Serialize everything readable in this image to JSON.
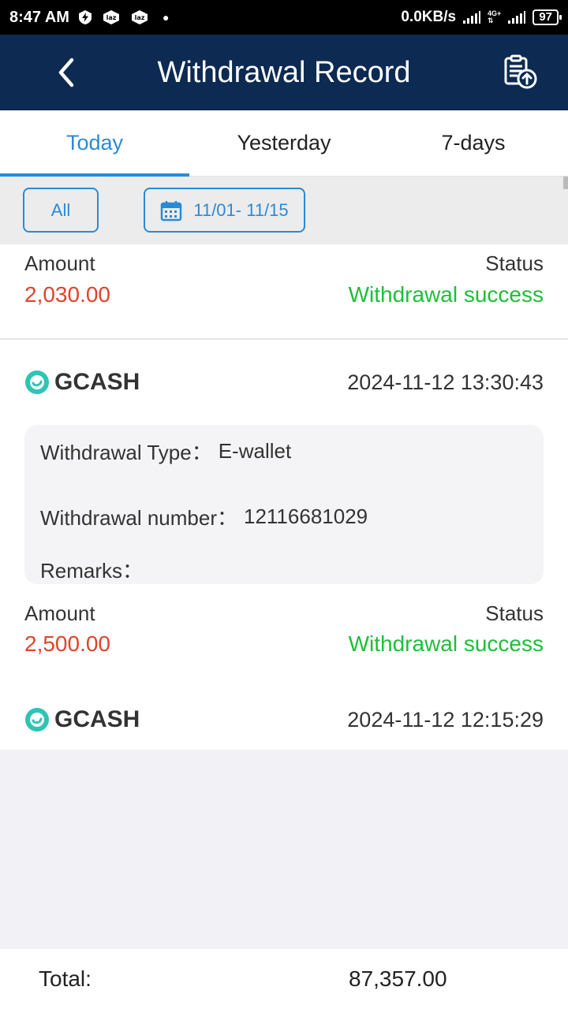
{
  "status_bar": {
    "time": "8:47 AM",
    "network_speed": "0.0KB/s",
    "network_type": "4G+",
    "battery": "97",
    "app_icon_1": "laz",
    "app_icon_2": "laz"
  },
  "header": {
    "title": "Withdrawal Record",
    "back_icon": "back-arrow-icon",
    "action_icon": "record-upload-icon"
  },
  "tabs": [
    {
      "label": "Today",
      "active": true
    },
    {
      "label": "Yesterday",
      "active": false
    },
    {
      "label": "7-days",
      "active": false
    }
  ],
  "filters": {
    "all_label": "All",
    "date_range": "11/01- 11/15"
  },
  "labels": {
    "amount": "Amount",
    "status": "Status",
    "withdrawal_type": "Withdrawal Type：",
    "withdrawal_number": "Withdrawal number：",
    "remarks": "Remarks："
  },
  "records": [
    {
      "amount": "2,030.00",
      "status": "Withdrawal success"
    },
    {
      "method": "GCASH",
      "datetime": "2024-11-12 13:30:43",
      "type": "E-wallet",
      "number": "12116681029",
      "remarks": "",
      "amount": "2,500.00",
      "status": "Withdrawal success"
    },
    {
      "method": "GCASH",
      "datetime": "2024-11-12 12:15:29"
    }
  ],
  "footer": {
    "total_label": "Total:",
    "total_value": "87,357.00"
  },
  "colors": {
    "header_bg": "#0d2a52",
    "accent": "#2a8ad6",
    "amount": "#e0442a",
    "success": "#1dbf38",
    "gcash": "#2ec4b6"
  }
}
